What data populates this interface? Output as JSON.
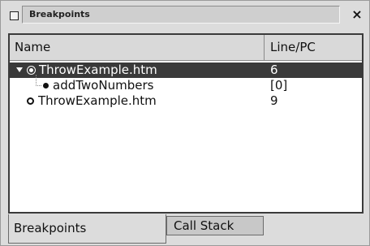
{
  "window": {
    "title": "Breakpoints",
    "close_glyph": "×"
  },
  "table": {
    "columns": {
      "name": "Name",
      "line": "Line/PC"
    },
    "rows": [
      {
        "name": "ThrowExample.htm",
        "line": "6",
        "selected": true,
        "expanded": true,
        "icon": "breakpoint-icon"
      },
      {
        "name": "addTwoNumbers",
        "line": "[0]",
        "selected": false,
        "child": true,
        "icon": "breakpoint-dot-icon"
      },
      {
        "name": "ThrowExample.htm",
        "line": "9",
        "selected": false,
        "icon": "breakpoint-icon"
      }
    ]
  },
  "tabs": {
    "breakpoints": "Breakpoints",
    "callstack": "Call Stack"
  },
  "colors": {
    "selection": "#3a3a3a",
    "background": "#dcdcdc",
    "list_bg": "#ffffff"
  }
}
